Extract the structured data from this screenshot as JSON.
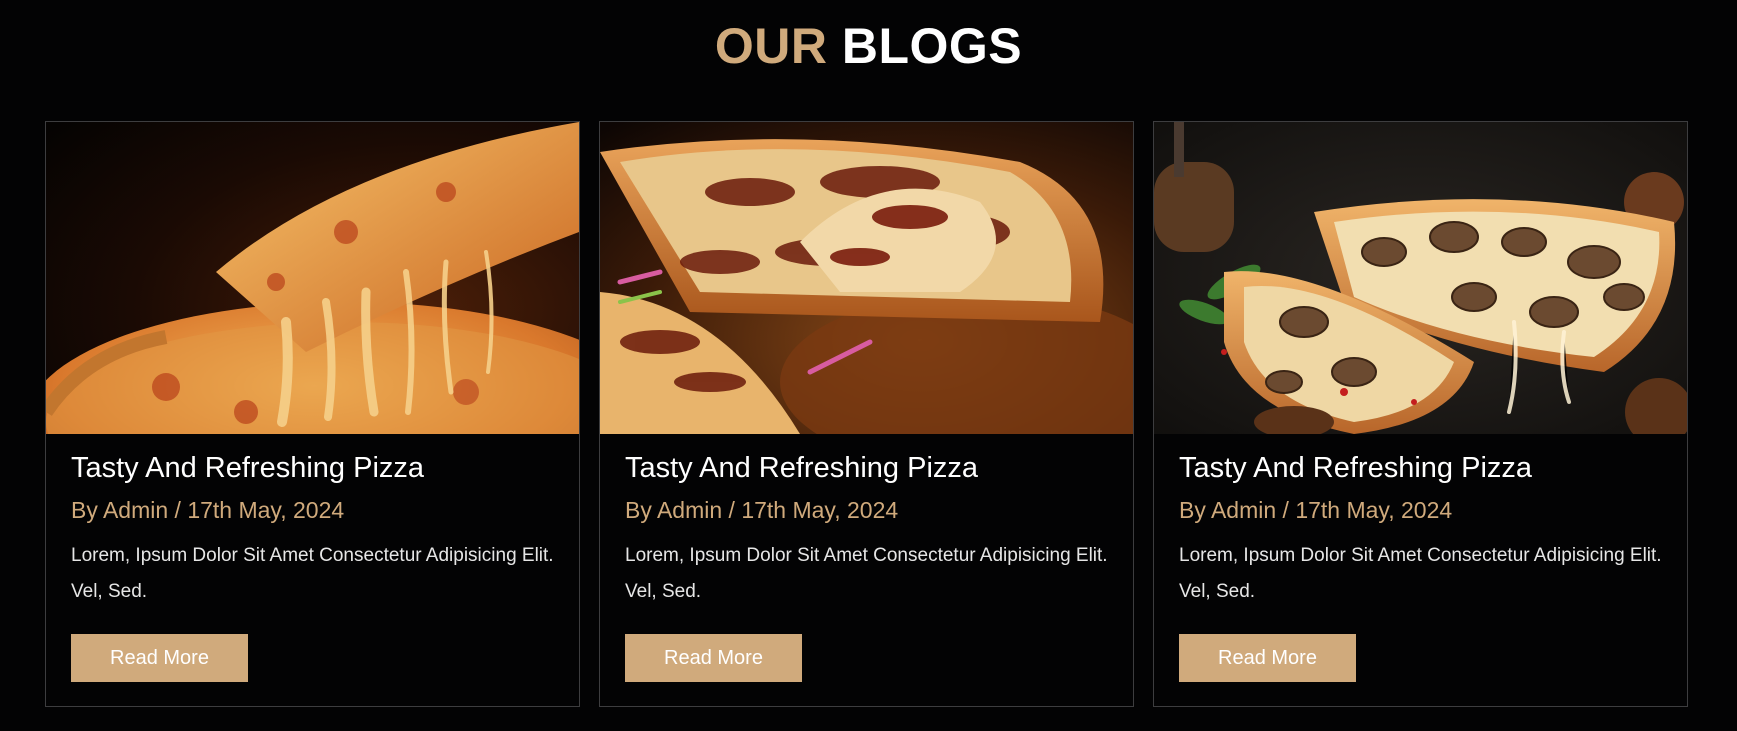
{
  "section": {
    "heading_accent": "OUR",
    "heading_rest": "BLOGS"
  },
  "posts": [
    {
      "title": "Tasty And Refreshing Pizza",
      "meta": "By Admin / 17th May, 2024",
      "excerpt": "Lorem, Ipsum Dolor Sit Amet Consectetur Adipisicing Elit. Vel, Sed.",
      "button": "Read More",
      "image": "cheese-pizza-pull-photo"
    },
    {
      "title": "Tasty And Refreshing Pizza",
      "meta": "By Admin / 17th May, 2024",
      "excerpt": "Lorem, Ipsum Dolor Sit Amet Consectetur Adipisicing Elit. Vel, Sed.",
      "button": "Read More",
      "image": "bbq-chicken-pizza-photo"
    },
    {
      "title": "Tasty And Refreshing Pizza",
      "meta": "By Admin / 17th May, 2024",
      "excerpt": "Lorem, Ipsum Dolor Sit Amet Consectetur Adipisicing Elit. Vel, Sed.",
      "button": "Read More",
      "image": "mushroom-pizza-photo"
    }
  ],
  "colors": {
    "background": "#030304",
    "accent": "#d0aa7c",
    "border": "#3d3d3f",
    "text": "#ffffff"
  }
}
